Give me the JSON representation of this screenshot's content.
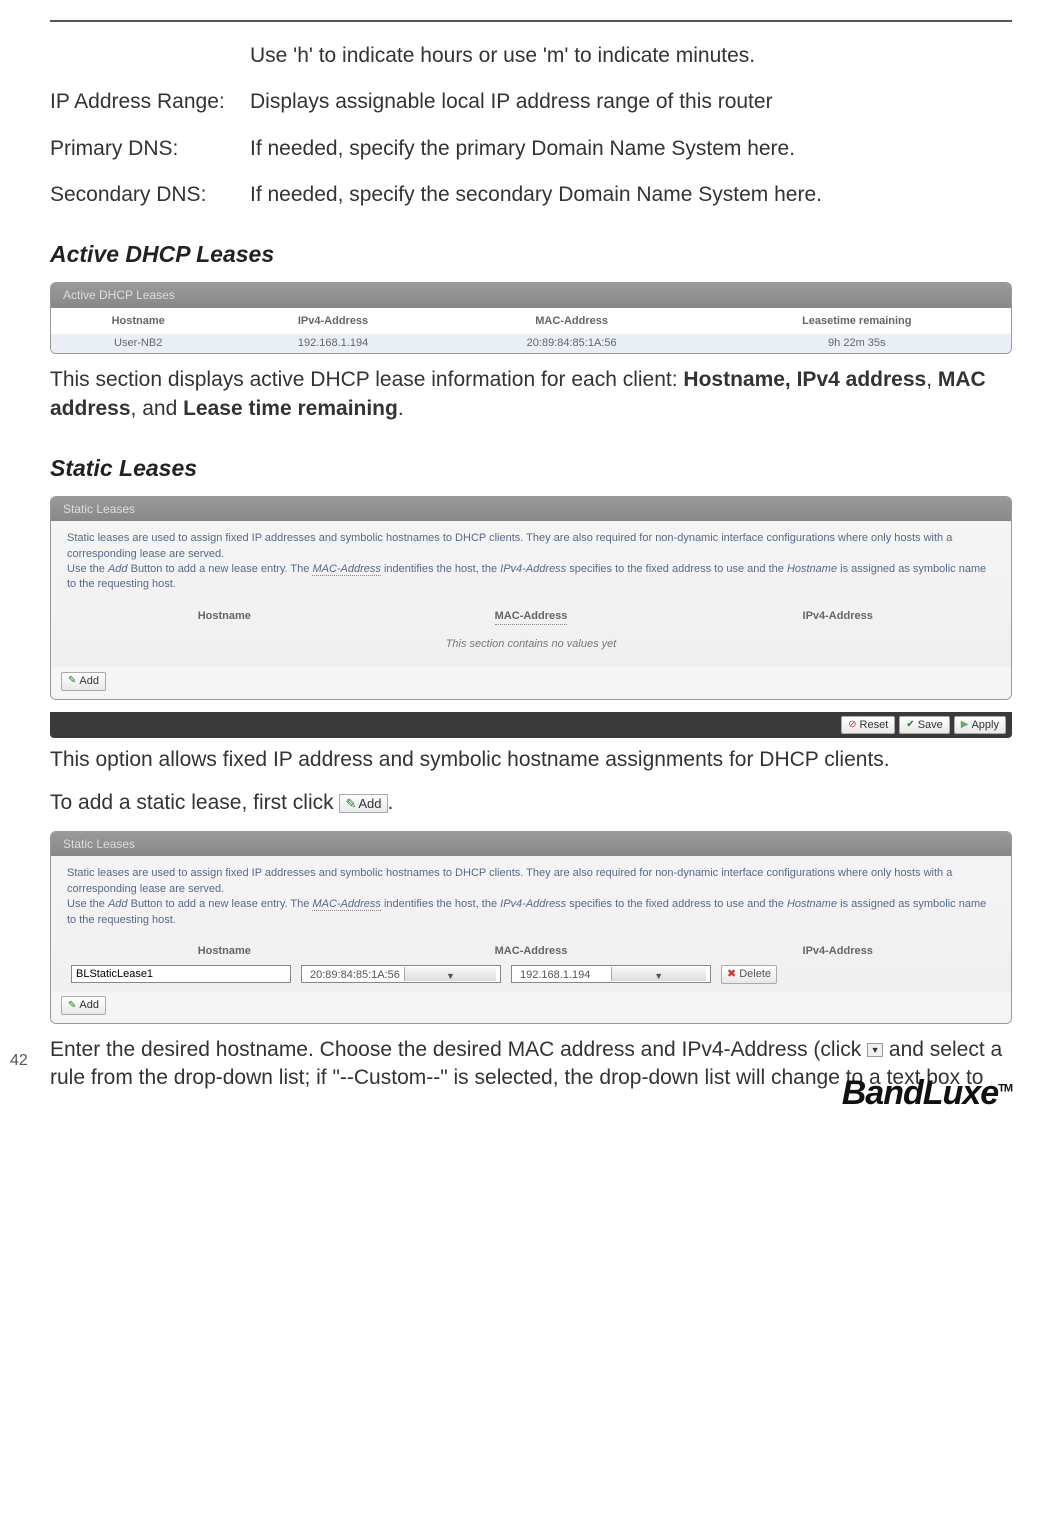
{
  "defs": {
    "lease_time_desc": "Use 'h' to indicate hours or use 'm' to indicate minutes.",
    "ip_range_term": "IP Address Range:",
    "ip_range_desc": "Displays assignable local IP address range of this router",
    "primary_dns_term": "Primary DNS:",
    "primary_dns_desc": "If needed, specify the primary Domain Name System here.",
    "secondary_dns_term": "Secondary DNS:",
    "secondary_dns_desc": "If needed, specify the secondary Domain Name System here."
  },
  "active_dhcp": {
    "title": "Active DHCP Leases",
    "panel_header": "Active DHCP Leases",
    "headers": {
      "hostname": "Hostname",
      "ipv4": "IPv4-Address",
      "mac": "MAC-Address",
      "lease": "Leasetime remaining"
    },
    "row": {
      "hostname": "User-NB2",
      "ipv4": "192.168.1.194",
      "mac": "20:89:84:85:1A:56",
      "lease": "9h 22m 35s"
    },
    "para_pre": "This section displays active DHCP lease information for each client: ",
    "para_bold1": "Hostname, IPv4 address",
    "para_sep1": ", ",
    "para_bold2": "MAC address",
    "para_sep2": ", and ",
    "para_bold3": "Lease time remaining",
    "para_end": "."
  },
  "static_leases": {
    "title": "Static Leases",
    "panel_header": "Static Leases",
    "desc1": "Static leases are used to assign fixed IP addresses and symbolic hostnames to DHCP clients. They are also required for non-dynamic interface configurations where only hosts with a corresponding lease are served.",
    "desc2_pre": "Use the ",
    "desc2_add": "Add",
    "desc2_mid1": " Button to add a new lease entry. The ",
    "desc2_mac": "MAC-Address",
    "desc2_mid2": " indentifies the host, the ",
    "desc2_ipv4": "IPv4-Address",
    "desc2_mid3": " specifies to the fixed address to use and the ",
    "desc2_host": "Hostname",
    "desc2_end": " is assigned as symbolic name to the requesting host.",
    "col_hostname": "Hostname",
    "col_mac": "MAC-Address",
    "col_ipv4": "IPv4-Address",
    "no_values": "This section contains no values yet",
    "add_label": "Add",
    "reset_label": "Reset",
    "save_label": "Save",
    "apply_label": "Apply",
    "para1": "This option allows fixed IP address and symbolic hostname assignments for DHCP clients.",
    "para2_pre": "To add a static lease, first click ",
    "para2_end": "."
  },
  "static_leases2": {
    "row": {
      "hostname": "BLStaticLease1",
      "mac": "20:89:84:85:1A:56",
      "ipv4": "192.168.1.194"
    },
    "delete_label": "Delete"
  },
  "final_para": {
    "line1": "Enter the desired hostname. Choose the desired MAC address and IPv4-Address (click ",
    "line2": " and select a rule from the drop-down list; if \"--Custom--\" is selected, the drop-down list will change to a text box to"
  },
  "page_number": "42",
  "brand": "BandLuxe",
  "tm": "TM"
}
